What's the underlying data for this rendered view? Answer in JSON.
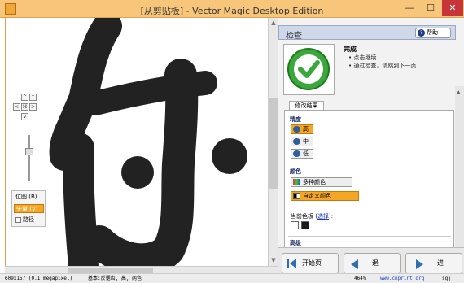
{
  "window": {
    "title": "[从剪贴板] - Vector Magic Desktop Edition",
    "minimize": "—",
    "maximize": "☐",
    "close": "✕"
  },
  "canvas": {
    "nav": {
      "up": "^",
      "up2": "⌃",
      "left": "<",
      "right": ">",
      "center": "⌘",
      "down": "v"
    },
    "view_options": {
      "bitmap": "位图 (B)",
      "vector": "矢量 (V)",
      "path": "路径"
    }
  },
  "panel": {
    "header": "检查",
    "help": "帮助",
    "done_title": "完成",
    "done_steps": [
      "点击继续",
      "通过检查，请跳到下一页"
    ],
    "tab_label": "修改结果",
    "quality": {
      "title": "精度",
      "options": [
        "高",
        "中",
        "低"
      ],
      "selected": "高"
    },
    "colors": {
      "title": "颜色",
      "multi": "多种颜色",
      "custom": "自定义颜色",
      "selected": "自定义颜色",
      "palette_label": "当前色板",
      "palette_link": "选择",
      "palette_suffix": "):",
      "swatches": [
        "#ffffff",
        "#1a1a1a"
      ]
    },
    "advanced_title": "高级",
    "nav": {
      "start": "开始页",
      "back": "退",
      "forward": "进"
    }
  },
  "status": {
    "dimensions": "609x157 (0.1 megapixel)",
    "info": "基本:反锯齿, 高, 两色",
    "zoom": "464%",
    "link": "www.cnprint.org",
    "user": "sgj"
  },
  "colors": {
    "title_bar": "#f7c67a",
    "accent": "#f5a624",
    "glyph": "#222222",
    "check_green": "#3aa83a"
  }
}
